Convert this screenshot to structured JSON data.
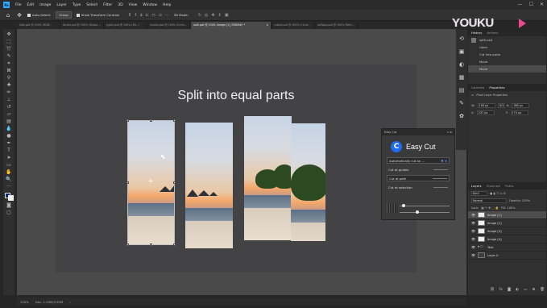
{
  "app": {
    "logo": "Ps",
    "menu": [
      "File",
      "Edit",
      "Image",
      "Layer",
      "Type",
      "Select",
      "Filter",
      "3D",
      "View",
      "Window",
      "Help"
    ],
    "window_controls": [
      "—",
      "☐",
      "✕"
    ]
  },
  "options_bar": {
    "auto_select_label": "Auto-Select:",
    "auto_select_value": "Group",
    "transform_label": "Show Transform Controls",
    "mode_3d": "3D Mode:"
  },
  "tabs": [
    {
      "label": "hike.psd @ 100% (RGB/...",
      "active": false
    },
    {
      "label": "tactile.psd @ 100% (Shape ...",
      "active": false
    },
    {
      "label": "typen.psd @ 100% (AR...)",
      "active": false
    },
    {
      "label": "events.psd @ 100% (Circle...",
      "active": false
    },
    {
      "label": "split.psd @ 100% (Image [1], RGB/8#) *",
      "active": true
    },
    {
      "label": "cutout.psd @ 100% (Circle...",
      "active": false
    },
    {
      "label": "artflags.psd @ 100% (Rect...",
      "active": false
    }
  ],
  "canvas": {
    "title": "Split into equal parts"
  },
  "plugin": {
    "header": "Easy Cut",
    "header_controls": "«  ≡",
    "logo_letter": "C",
    "title": "Easy Cut",
    "auto_cut_label": "Automatically cut on ...",
    "cut_guides": "Cut at guides",
    "cut_path": "Cut at path",
    "cut_selection": "Cut at selection"
  },
  "history_panel": {
    "tabs": [
      "History",
      "Actions"
    ],
    "items": [
      "split.psd",
      "Open",
      "Cut into parts",
      "Move",
      "Move"
    ]
  },
  "properties_panel": {
    "tabs": [
      "Libraries",
      "Properties"
    ],
    "kind": "Pixel Layer Properties",
    "w_label": "W:",
    "w_value": "106 px",
    "h_label": "H:",
    "h_value": "365 px",
    "x_label": "X:",
    "x_value": "237 px",
    "y_label": "Y:",
    "y_value": "172 px",
    "link": "GO"
  },
  "layers_panel": {
    "tabs": [
      "Layers",
      "Channels",
      "Paths"
    ],
    "filter": "Kind",
    "blend_mode": "Normal",
    "opacity": "Opacity: 100%",
    "fill": "Fill: 100%",
    "lock": "Lock:",
    "layers": [
      {
        "name": "Image [1]",
        "selected": true,
        "type": "image"
      },
      {
        "name": "Image [2]",
        "selected": false,
        "type": "image"
      },
      {
        "name": "Image [3]",
        "selected": false,
        "type": "image"
      },
      {
        "name": "Image [4]",
        "selected": false,
        "type": "image"
      },
      {
        "name": "Text",
        "selected": false,
        "type": "folder"
      },
      {
        "name": "Layer 0",
        "selected": false,
        "type": "dark"
      }
    ]
  },
  "status_bar": {
    "zoom": "100%",
    "doc": "Doc: 1.09M/3.63M",
    "arrow": "›"
  },
  "watermark": {
    "text": "YOUKU"
  },
  "colors": {
    "accent": "#31a8ff",
    "easycut_blue": "#1e6cf0",
    "canvas_bg": "#434244",
    "workspace_bg": "#4a4a4a"
  }
}
